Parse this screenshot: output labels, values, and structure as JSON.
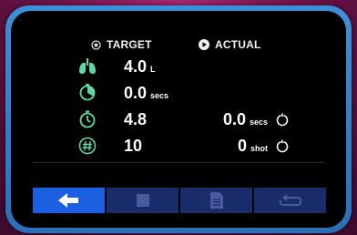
{
  "header": {
    "target_label": "TARGET",
    "actual_label": "ACTUAL"
  },
  "rows": [
    {
      "icon": "lungs-icon",
      "target_value": "4.0",
      "target_unit": "L",
      "actual_value": "",
      "actual_unit": "",
      "has_reset": false
    },
    {
      "icon": "timer-icon",
      "target_value": "0.0",
      "target_unit": "secs",
      "actual_value": "",
      "actual_unit": "",
      "has_reset": false
    },
    {
      "icon": "stopwatch-icon",
      "target_value": "4.8",
      "target_unit": "",
      "actual_value": "0.0",
      "actual_unit": "secs",
      "has_reset": true
    },
    {
      "icon": "hash-counter-icon",
      "target_value": "10",
      "target_unit": "",
      "actual_value": "0",
      "actual_unit": "shot",
      "has_reset": true
    }
  ],
  "toolbar": {
    "buttons": [
      {
        "icon": "back-arrow-icon",
        "active": true
      },
      {
        "icon": "stop-icon",
        "active": false
      },
      {
        "icon": "document-icon",
        "active": false
      },
      {
        "icon": "repeat-icon",
        "active": false
      }
    ]
  },
  "colors": {
    "accent_green": "#5fd6a8",
    "toolbar_active": "#1c5fe0",
    "toolbar_inactive": "#1a2c6a",
    "frame_blue": "#3d8fd8"
  }
}
